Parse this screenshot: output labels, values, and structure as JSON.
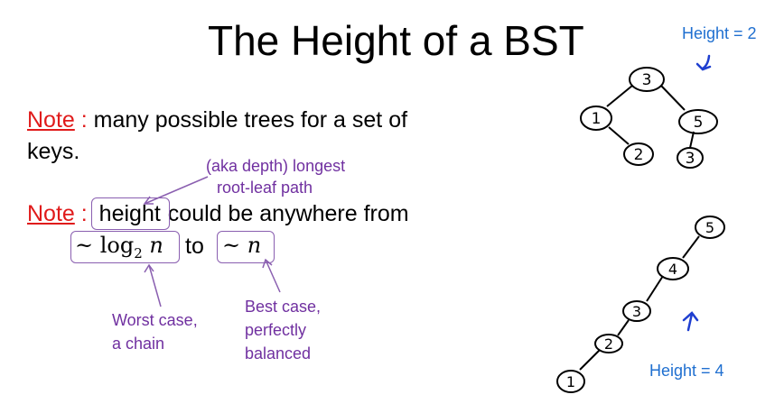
{
  "slide": {
    "title": "The Height of a BST",
    "note1": {
      "label": "Note",
      "sep": " :",
      "text_line1": " many possible trees for a set of",
      "text_line2": "keys."
    },
    "note2": {
      "label": "Note",
      "sep": " :",
      "height_word": "height",
      "text_after": "could be anywhere from",
      "log_expr_prefix": "~ log",
      "log_expr_sub": "2",
      "log_expr_var": " n",
      "to_word": "to",
      "n_expr": "~ n"
    },
    "annotations": {
      "depth_line1": "(aka depth) longest",
      "depth_line2": "root-leaf path",
      "worst_line1": "Worst case,",
      "worst_line2": "a chain",
      "best_line1": "Best case,",
      "best_line2": "perfectly",
      "best_line3": "balanced"
    },
    "tree1": {
      "height_label": "Height = 2",
      "nodes": [
        "3",
        "1",
        "5",
        "2",
        "3"
      ]
    },
    "tree2": {
      "height_label": "Height = 4",
      "nodes": [
        "5",
        "4",
        "3",
        "2",
        "1"
      ]
    },
    "colors": {
      "note_red": "#e01b1b",
      "annotation_purple": "#7030a0",
      "height_blue": "#1f6fd0"
    }
  }
}
